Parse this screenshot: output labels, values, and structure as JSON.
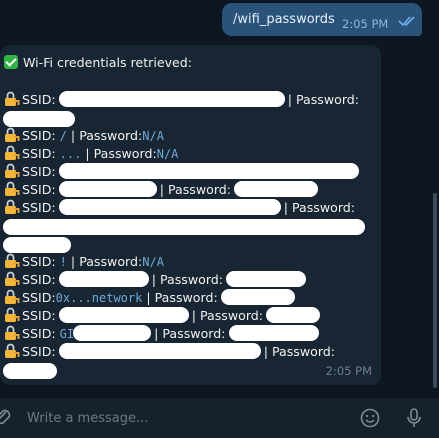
{
  "outgoing": {
    "text": "/wifi_passwords",
    "time": "2:05 PM"
  },
  "incoming": {
    "header": "Wi-Fi credentials retrieved:",
    "time": "2:05 PM",
    "ssid_label": "SSID:",
    "password_label": "Password:",
    "separator": "|",
    "na": "N/A",
    "ssid_slash": "/",
    "ssid_dots": "...",
    "ssid_bang": "!",
    "ssid_network": "0x...network",
    "ssid_gl": "GI"
  },
  "input": {
    "placeholder": "Write a message..."
  },
  "icons": [
    "attach-icon",
    "emoji-icon",
    "microphone-icon",
    "lock-key-icon",
    "check-icon",
    "double-check-icon"
  ],
  "colors": {
    "background": "#0e1621",
    "outgoing_bubble": "#2b5278",
    "incoming_bubble": "#182533",
    "code": "#6ea9d8"
  }
}
